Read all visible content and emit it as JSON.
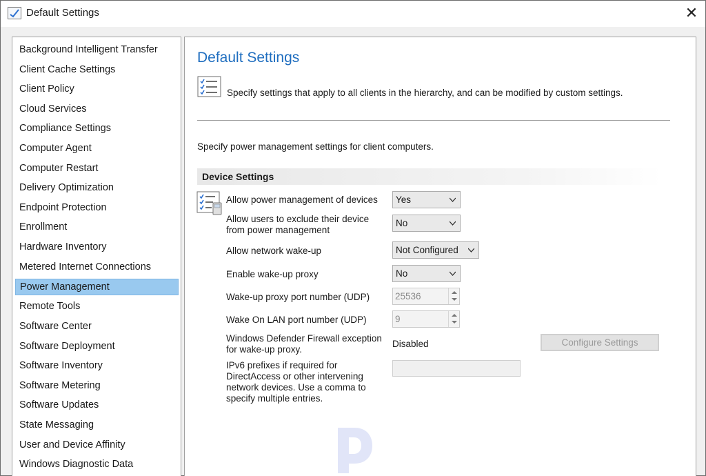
{
  "window": {
    "title": "Default Settings",
    "close_symbol": "✕"
  },
  "sidebar": {
    "items": [
      {
        "label": "Background Intelligent Transfer"
      },
      {
        "label": "Client Cache Settings"
      },
      {
        "label": "Client Policy"
      },
      {
        "label": "Cloud Services"
      },
      {
        "label": "Compliance Settings"
      },
      {
        "label": "Computer Agent"
      },
      {
        "label": "Computer Restart"
      },
      {
        "label": "Delivery Optimization"
      },
      {
        "label": "Endpoint Protection"
      },
      {
        "label": "Enrollment"
      },
      {
        "label": "Hardware Inventory"
      },
      {
        "label": "Metered Internet Connections"
      },
      {
        "label": "Power Management",
        "selected": true
      },
      {
        "label": "Remote Tools"
      },
      {
        "label": "Software Center"
      },
      {
        "label": "Software Deployment"
      },
      {
        "label": "Software Inventory"
      },
      {
        "label": "Software Metering"
      },
      {
        "label": "Software Updates"
      },
      {
        "label": "State Messaging"
      },
      {
        "label": "User and Device Affinity"
      },
      {
        "label": "Windows Diagnostic Data"
      }
    ]
  },
  "main": {
    "title": "Default Settings",
    "description": "Specify settings that apply to all clients in the hierarchy, and can be modified by custom settings.",
    "subdescription": "Specify power management settings for client computers.",
    "section_title": "Device Settings",
    "settings": {
      "allow_power_mgmt": {
        "label": "Allow power management of devices",
        "value": "Yes"
      },
      "allow_exclude": {
        "label_line1": "Allow users to exclude their device",
        "label_line2": "from power management",
        "value": "No"
      },
      "allow_wake": {
        "label": "Allow network wake-up",
        "value": "Not Configured"
      },
      "wake_proxy": {
        "label": "Enable wake-up proxy",
        "value": "No"
      },
      "proxy_port": {
        "label": "Wake-up proxy port number (UDP)",
        "value": "25536"
      },
      "wol_port": {
        "label": "Wake On LAN port number (UDP)",
        "value": "9"
      },
      "firewall": {
        "label_line1": "Windows Defender Firewall exception",
        "label_line2": "for wake-up proxy.",
        "value": "Disabled",
        "button": "Configure Settings"
      },
      "ipv6": {
        "label_line1": "IPv6 prefixes if required for",
        "label_line2": "DirectAccess or other intervening",
        "label_line3": "network devices. Use a comma to",
        "label_line4": "specify multiple entries.",
        "value": ""
      }
    }
  },
  "icons": {
    "title": "settings-window-icon",
    "header": "checklist-icon",
    "settings": "checklist-settings-icon",
    "watermark": "watermark-logo"
  },
  "colors": {
    "accent": "#1e6dbf",
    "selection": "#99c9ef"
  }
}
